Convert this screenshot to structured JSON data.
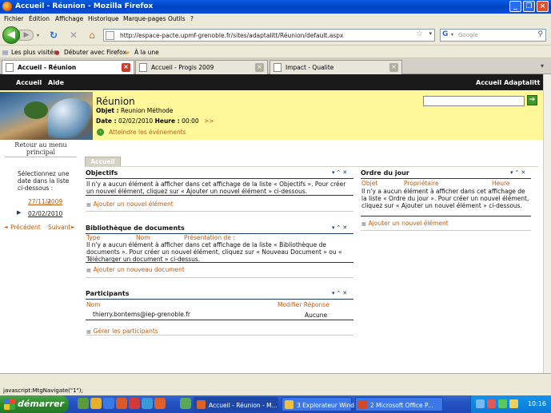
{
  "window": {
    "title": "Accueil - Réunion - Mozilla Firefox"
  },
  "menu": [
    "Fichier",
    "Édition",
    "Affichage",
    "Historique",
    "Marque-pages",
    "Outils",
    "?"
  ],
  "nav": {
    "url": "http://espace-pacte.upmf-grenoble.fr/sites/adaptalitt/Réunion/default.aspx",
    "search_placeholder": "Google"
  },
  "bookmarks": [
    "Les plus visités",
    "Débuter avec Firefox",
    "À la une"
  ],
  "tabs": [
    {
      "label": "Accueil - Réunion",
      "active": true
    },
    {
      "label": "Accueil - Progis 2009",
      "active": false
    },
    {
      "label": "Impact - Qualite",
      "active": false
    }
  ],
  "sp": {
    "topnav": {
      "home": "Accueil",
      "help": "Aide",
      "site": "Accueil Adaptalitt"
    },
    "header": {
      "title": "Réunion",
      "objet_label": "Objet :",
      "objet_value": "Reunion Méthode",
      "date_label": "Date :",
      "date_value": "02/02/2010",
      "heure_label": "Heure :",
      "heure_value": "00:00",
      "next": ">>",
      "events_link": "Atteindre les événements"
    },
    "left": {
      "retour": "Retour au menu principal",
      "instructions": "Sélectionnez une date dans la liste ci-dessous :",
      "dates": [
        "27/11/2009",
        "02/02/2010"
      ],
      "prev": "Précédent",
      "next": "Suivant"
    },
    "page_tab": "Accueil",
    "objectifs": {
      "title": "Objectifs",
      "text": "Il n'y a aucun élément à afficher dans cet affichage de la liste « Objectifs ». Pour créer un nouvel élément, cliquez sur « Ajouter un nouvel élément » ci-dessous.",
      "add": "Ajouter un nouvel élément"
    },
    "ordre": {
      "title": "Ordre du jour",
      "cols": [
        "Objet",
        "Propriétaire",
        "Heure"
      ],
      "text": "Il n'y a aucun élément à afficher dans cet affichage de la liste « Ordre du jour ». Pour créer un nouvel élément, cliquez sur « Ajouter un nouvel élément » ci-dessous.",
      "add": "Ajouter un nouvel élément"
    },
    "biblio": {
      "title": "Bibliothèque de documents",
      "cols": [
        "Type",
        "Nom",
        "Présentation de :"
      ],
      "text": "Il n'y a aucun élément à afficher dans cet affichage de la liste « Bibliothèque de documents ». Pour créer un nouvel élément, cliquez sur « Nouveau Document » ou « Télécharger un document » ci-dessus.",
      "add": "Ajouter un nouveau document"
    },
    "participants": {
      "title": "Participants",
      "cols": [
        "Nom",
        "Modifier Réponse"
      ],
      "rows": [
        {
          "name": "thierry.bontems@iep-grenoble.fr",
          "response": "Aucune"
        }
      ],
      "manage": "Gérer les participants"
    }
  },
  "status": "javascript:MtgNavigate(\"1\");",
  "taskbar": {
    "start": "démarrer",
    "tasks": [
      "Accueil - Réunion - M...",
      "3 Explorateur Wind...",
      "2 Microsoft Office P..."
    ],
    "clock": "10:16"
  },
  "colors": {
    "accent_orange": "#c85b0f",
    "header_yellow": "#fff89a",
    "topnav_black": "#1a1a1a"
  }
}
